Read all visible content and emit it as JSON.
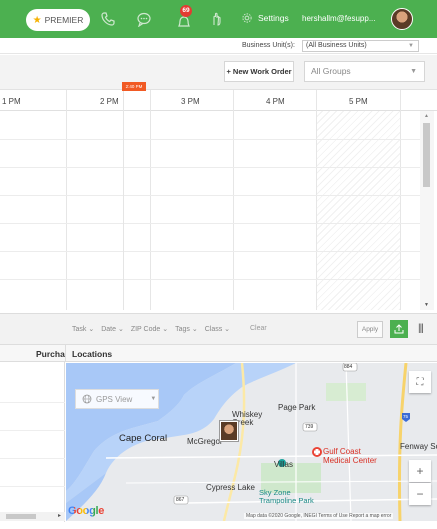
{
  "header": {
    "premier_label": "PREMIER",
    "notification_count": "69",
    "settings_label": "Settings",
    "user_email": "hershallm@fesupp..."
  },
  "business_unit": {
    "label": "Business Unit(s):",
    "value": "(All Business Units)"
  },
  "toolbar": {
    "new_work_order": "+ New Work Order",
    "groups_placeholder": "All Groups"
  },
  "schedule": {
    "hours": [
      "1 PM",
      "2 PM",
      "3 PM",
      "4 PM",
      "5 PM"
    ],
    "current_time": "2:40 PM"
  },
  "filters": {
    "items": [
      "Task",
      "Date",
      "ZIP Code",
      "Tags",
      "Class"
    ],
    "clear_label": "Clear",
    "apply_label": "Apply"
  },
  "lower": {
    "purchase_header": "Purcha",
    "locations_header": "Locations"
  },
  "map": {
    "gps_view": "GPS View",
    "labels": {
      "cape_coral": "Cape Coral",
      "mcgregor": "McGregor",
      "whiskey_creek": "Whiskey Creek",
      "page_park": "Page Park",
      "fenway": "Fenway Sou",
      "villas": "Villas",
      "gulf_coast": "Gulf Coast Medical Center",
      "cypress_lake": "Cypress Lake",
      "sky_zone": "Sky Zone Trampoline Park",
      "road_884": "884",
      "road_739": "739",
      "road_867": "867",
      "road_75": "75"
    },
    "google": "Google",
    "attribution": "Map data ©2020 Google, INEGI   Terms of Use   Report a map error"
  },
  "colors": {
    "brand_green": "#4cb050",
    "now_marker": "#f15a24",
    "badge_red": "#e33b32"
  }
}
